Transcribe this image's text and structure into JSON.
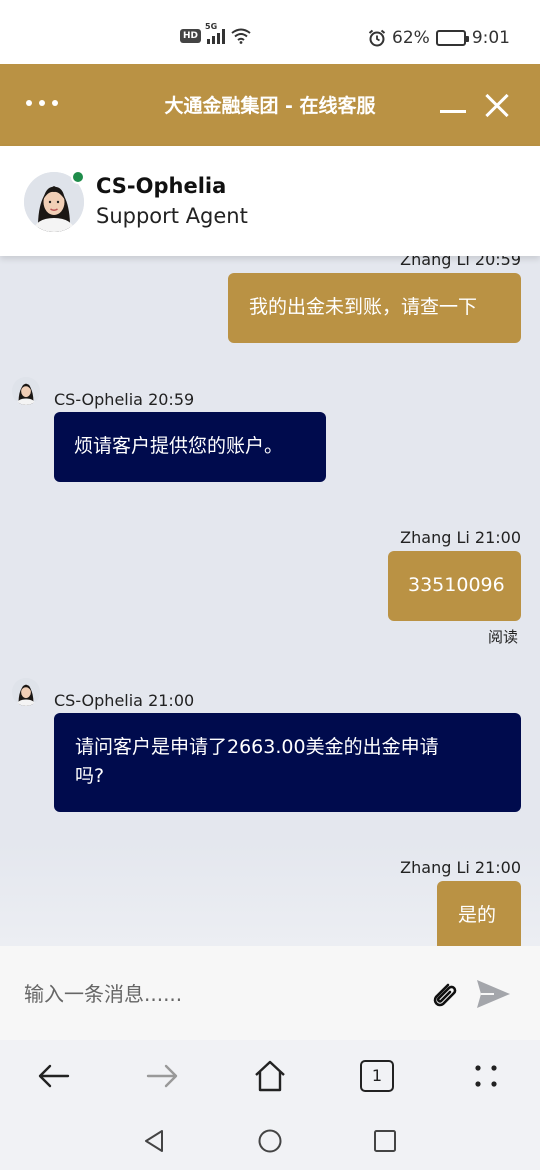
{
  "status_bar": {
    "network_badge": "HD",
    "network_type": "5G",
    "battery_percent": "62%",
    "battery_level": 0.62,
    "time": "9:01"
  },
  "header": {
    "title": "大通金融集团 - 在线客服",
    "menu_icon": "more-dots-icon",
    "minimize_icon": "minimize-icon",
    "close_icon": "close-icon",
    "accent_color": "#ba9244"
  },
  "agent": {
    "name": "CS-Ophelia",
    "role": "Support Agent",
    "status_color": "#1e8c4a"
  },
  "messages": [
    {
      "direction": "out",
      "sender_time": "Zhang Li 20:59",
      "text": "我的出金未到账，请查一下"
    },
    {
      "direction": "in",
      "sender_time": "CS-Ophelia 20:59",
      "text": "烦请客户提供您的账户。"
    },
    {
      "direction": "out",
      "sender_time": "Zhang Li 21:00",
      "text": "33510096",
      "status": "阅读"
    },
    {
      "direction": "in",
      "sender_time": "CS-Ophelia 21:00",
      "text_lines": [
        "请问客户是申请了2663.00美金的出金申请",
        "吗?"
      ]
    },
    {
      "direction": "out",
      "sender_time": "Zhang Li 21:00",
      "text": "是的"
    }
  ],
  "composer": {
    "placeholder": "输入一条消息......",
    "attach_icon": "paperclip-icon",
    "send_icon": "send-icon"
  },
  "browser_nav": {
    "tab_count": "1",
    "icons": [
      "back-arrow-icon",
      "forward-arrow-icon",
      "home-icon",
      "tabs-icon",
      "more-icon"
    ]
  },
  "system_nav": {
    "icons": [
      "back-triangle-icon",
      "home-circle-icon",
      "recents-square-icon"
    ]
  },
  "colors": {
    "outgoing_bubble": "#ba9244",
    "incoming_bubble": "#000b4d",
    "chat_background": "#e4e7ee"
  }
}
